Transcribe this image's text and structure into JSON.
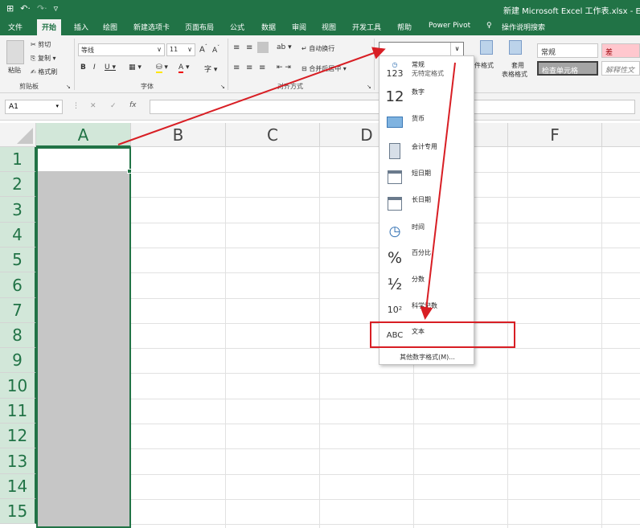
{
  "window": {
    "qat": [
      "⊞",
      "↶·",
      "↷·",
      "▿"
    ],
    "title": "新建 Microsoft Excel 工作表.xlsx  -  Exce"
  },
  "tabs": [
    "文件",
    "开始",
    "插入",
    "绘图",
    "新建选项卡",
    "页面布局",
    "公式",
    "数据",
    "审阅",
    "视图",
    "开发工具",
    "帮助",
    "Power Pivot",
    "操作说明搜索"
  ],
  "ribbon": {
    "paste": "粘贴",
    "cut": "剪切",
    "copy": "复制",
    "format_painter": "格式刷",
    "clipboard_group": "剪贴板",
    "font_name": "等线",
    "font_size": "11",
    "font_group": "字体",
    "wrap_text": "自动换行",
    "merge_center": "合并后居中",
    "align_group": "对齐方式",
    "cond_format": "件格式",
    "table_format_1": "套用",
    "table_format_2": "表格格式",
    "style_normal": "常规",
    "style_bad": "差",
    "style_check": "检查单元格",
    "style_explain": "解释性文"
  },
  "formula": {
    "name_box": "A1",
    "cancel": "✕",
    "enter": "✓",
    "fx": "fx"
  },
  "columns": [
    "A",
    "B",
    "C",
    "D",
    "E",
    "F"
  ],
  "rows": [
    "1",
    "2",
    "3",
    "4",
    "5",
    "6",
    "7",
    "8",
    "9",
    "10",
    "11",
    "12",
    "13",
    "14",
    "15"
  ],
  "number_format_menu": {
    "items": [
      {
        "label": "常规",
        "sub": "无特定格式",
        "icon": "123"
      },
      {
        "label": "数字",
        "icon": "12"
      },
      {
        "label": "货币",
        "icon": "currency"
      },
      {
        "label": "会计专用",
        "icon": "calculator"
      },
      {
        "label": "短日期",
        "icon": "calendar"
      },
      {
        "label": "长日期",
        "icon": "calendar"
      },
      {
        "label": "时间",
        "icon": "clock"
      },
      {
        "label": "百分比",
        "icon": "%"
      },
      {
        "label": "分数",
        "icon": "½"
      },
      {
        "label": "科学记数",
        "icon": "10²"
      },
      {
        "label": "文本",
        "icon": "ABC"
      }
    ],
    "more": "其他数字格式(M)..."
  },
  "colors": {
    "accent": "#217346",
    "annotation_red": "#d81e24"
  }
}
